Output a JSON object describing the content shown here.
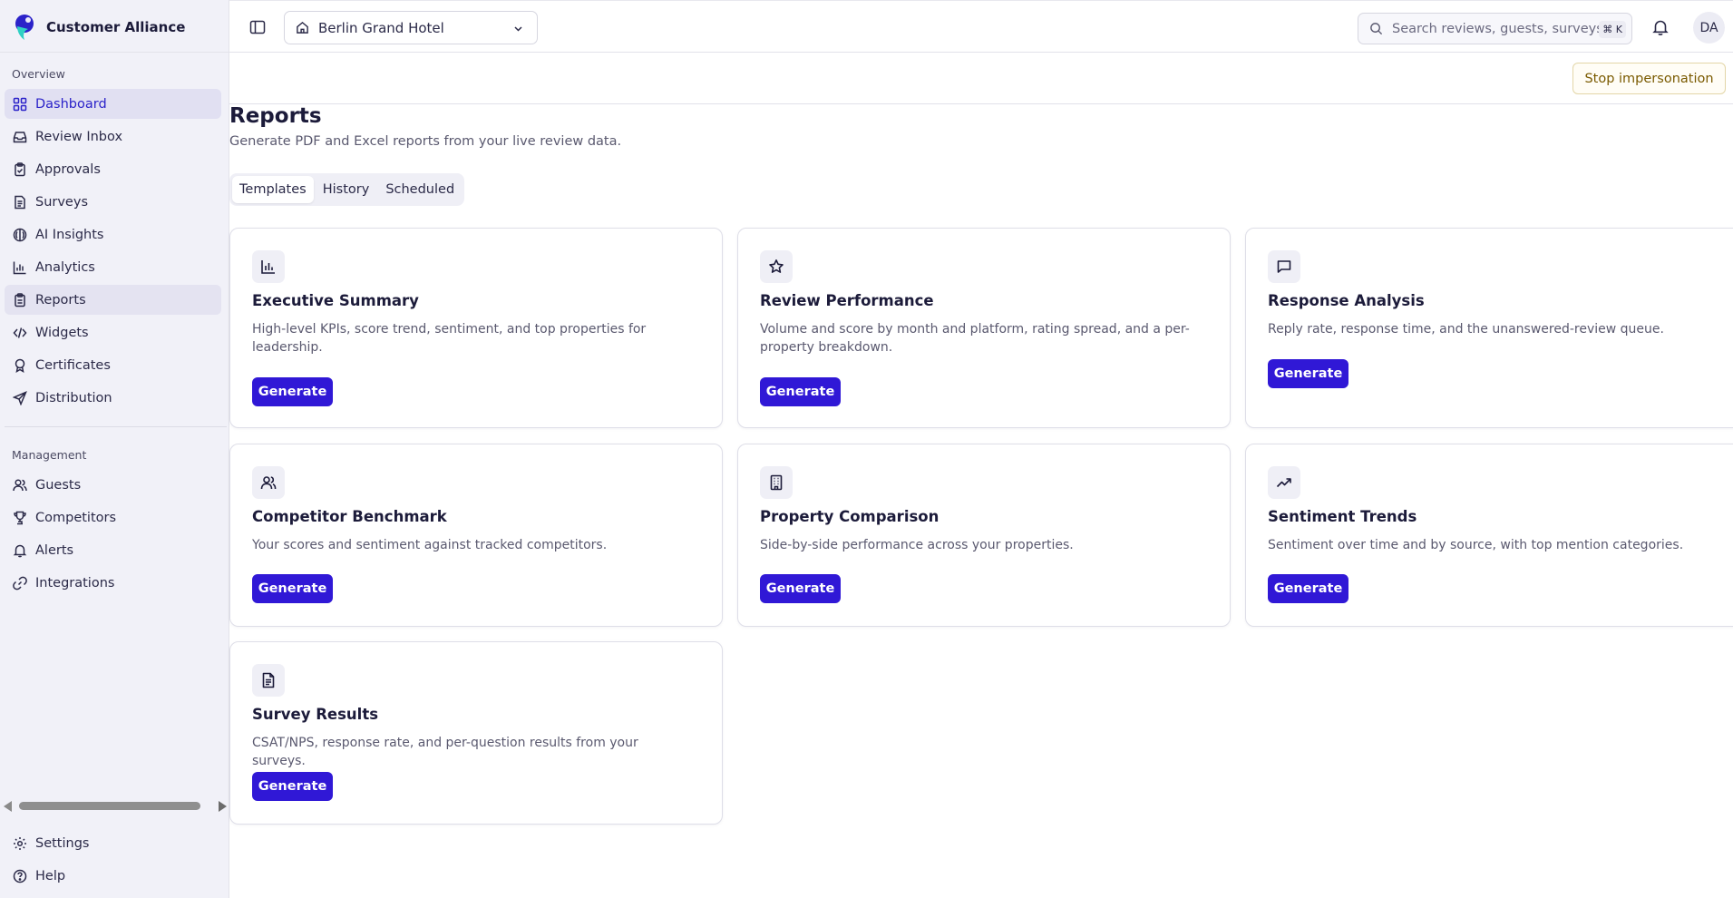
{
  "app": {
    "name": "Customer Alliance"
  },
  "sidebar": {
    "overview_label": "Overview",
    "overview_items": [
      {
        "label": "Dashboard",
        "icon": "dashboard-icon"
      },
      {
        "label": "Review Inbox",
        "icon": "inbox-icon"
      },
      {
        "label": "Approvals",
        "icon": "clipboard-check-icon"
      },
      {
        "label": "Surveys",
        "icon": "document-icon"
      },
      {
        "label": "AI Insights",
        "icon": "brain-icon"
      },
      {
        "label": "Analytics",
        "icon": "bar-chart-icon"
      },
      {
        "label": "Reports",
        "icon": "report-icon"
      },
      {
        "label": "Widgets",
        "icon": "code-icon"
      },
      {
        "label": "Certificates",
        "icon": "award-icon"
      },
      {
        "label": "Distribution",
        "icon": "send-icon"
      }
    ],
    "management_label": "Management",
    "management_items": [
      {
        "label": "Guests",
        "icon": "users-icon"
      },
      {
        "label": "Competitors",
        "icon": "trophy-icon"
      },
      {
        "label": "Alerts",
        "icon": "bell-icon"
      },
      {
        "label": "Integrations",
        "icon": "link-icon"
      }
    ],
    "bottom_items": [
      {
        "label": "Settings",
        "icon": "gear-icon"
      },
      {
        "label": "Help",
        "icon": "help-icon"
      }
    ]
  },
  "topbar": {
    "hotel": "Berlin Grand Hotel",
    "search_placeholder": "Search reviews, guests, surveys",
    "shortcut": "⌘ K",
    "avatar": "DA"
  },
  "impersonation": {
    "stop_label": "Stop impersonation"
  },
  "page": {
    "title": "Reports",
    "subtitle": "Generate PDF and Excel reports from your live review data.",
    "tabs": [
      "Templates",
      "History",
      "Scheduled"
    ],
    "active_tab": "Templates"
  },
  "templates": [
    {
      "title": "Executive Summary",
      "description": "High-level KPIs, score trend, sentiment, and top properties for leadership.",
      "icon": "bar-chart-icon",
      "button": "Generate"
    },
    {
      "title": "Review Performance",
      "description": "Volume and score by month and platform, rating spread, and a per-property breakdown.",
      "icon": "star-icon",
      "button": "Generate"
    },
    {
      "title": "Response Analysis",
      "description": "Reply rate, response time, and the unanswered-review queue.",
      "icon": "message-icon",
      "button": "Generate"
    },
    {
      "title": "Competitor Benchmark",
      "description": "Your scores and sentiment against tracked competitors.",
      "icon": "users-icon",
      "button": "Generate"
    },
    {
      "title": "Property Comparison",
      "description": "Side-by-side performance across your properties.",
      "icon": "building-icon",
      "button": "Generate"
    },
    {
      "title": "Sentiment Trends",
      "description": "Sentiment over time and by source, with top mention categories.",
      "icon": "trending-up-icon",
      "button": "Generate"
    },
    {
      "title": "Survey Results",
      "description": "CSAT/NPS, response rate, and per-question results from your surveys.",
      "icon": "file-text-icon",
      "button": "Generate"
    }
  ],
  "colors": {
    "primary": "#3018d6",
    "active_nav_bg": "#e1e0f2",
    "sidebar_bg": "#f1f1f8",
    "warning_text": "#7a5a00"
  }
}
